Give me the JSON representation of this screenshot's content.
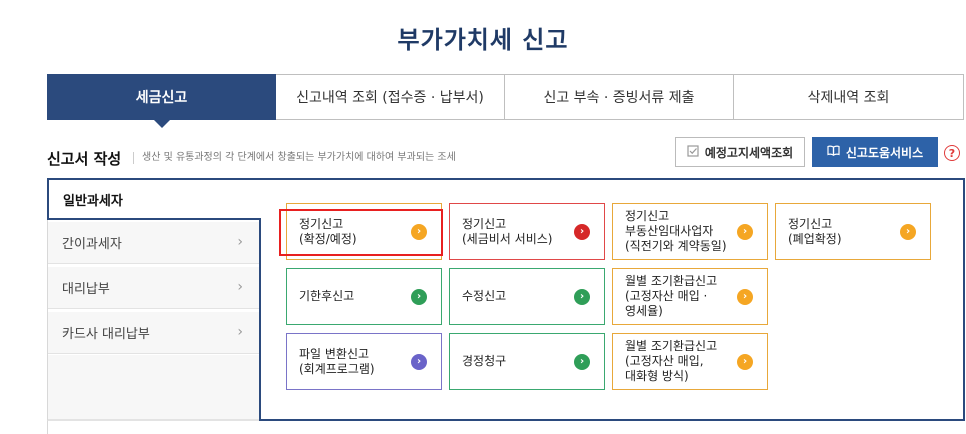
{
  "page": {
    "title": "부가가치세 신고"
  },
  "tabs": [
    {
      "label": "세금신고",
      "active": true
    },
    {
      "label": "신고내역 조회 (접수증 · 납부서)",
      "active": false
    },
    {
      "label": "신고 부속 · 증빙서류 제출",
      "active": false
    },
    {
      "label": "삭제내역 조회",
      "active": false
    }
  ],
  "section": {
    "title": "신고서 작성",
    "description": "생산 및 유통과정의 각 단계에서 창출되는 부가가치에 대하여 부과되는 조세"
  },
  "actions": {
    "estimate_label": "예정고지세액조회",
    "estimate_icon": "checkbox-icon",
    "help_service_label": "신고도움서비스",
    "help_service_icon": "book-icon",
    "help_mark": "?"
  },
  "sidebar": {
    "items": [
      {
        "label": "일반과세자",
        "active": true
      },
      {
        "label": "간이과세자",
        "active": false
      },
      {
        "label": "대리납부",
        "active": false
      },
      {
        "label": "카드사 대리납부",
        "active": false
      }
    ],
    "chevron": "›"
  },
  "cards": [
    {
      "label": "정기신고\n(확정/예정)",
      "color": "orange",
      "glyph": "›"
    },
    {
      "label": "정기신고\n(세금비서 서비스)",
      "color": "red",
      "glyph": "›"
    },
    {
      "label": "정기신고\n부동산임대사업자\n(직전기와 계약동일)",
      "color": "orange",
      "glyph": "›"
    },
    {
      "label": "정기신고\n(폐업확정)",
      "color": "orange",
      "glyph": "›"
    },
    {
      "label": "기한후신고",
      "color": "green",
      "glyph": "›"
    },
    {
      "label": "수정신고",
      "color": "green",
      "glyph": "›"
    },
    {
      "label": "월별 조기환급신고\n(고정자산 매입 ·\n영세율)",
      "color": "orange",
      "glyph": "›"
    },
    {
      "label": "파일 변환신고\n(회계프로그램)",
      "color": "purple",
      "glyph": "›"
    },
    {
      "label": "경정청구",
      "color": "green",
      "glyph": "›"
    },
    {
      "label": "월별 조기환급신고\n(고정자산 매입,\n대화형 방식)",
      "color": "orange",
      "glyph": "›"
    }
  ],
  "colors": {
    "primary": "#2b4a7d",
    "accent_blue": "#2d62a8",
    "orange": "#f5a623",
    "red": "#d62828",
    "green": "#2f9e58",
    "purple": "#6a63c9",
    "highlight": "#e82020"
  }
}
